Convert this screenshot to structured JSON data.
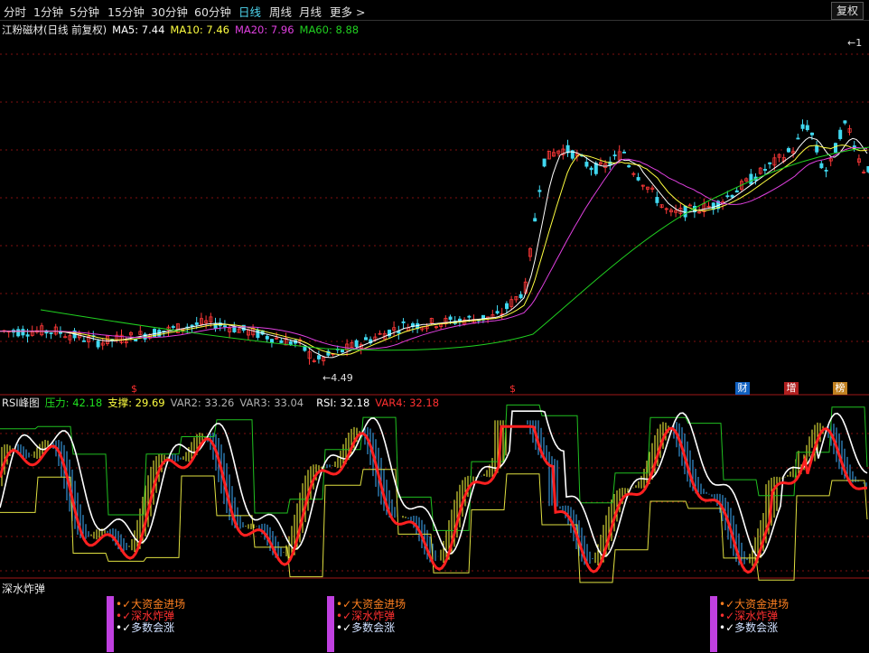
{
  "toolbar": {
    "tabs": [
      "分时",
      "1分钟",
      "5分钟",
      "15分钟",
      "30分钟",
      "60分钟",
      "日线",
      "周线",
      "月线",
      "更多 >"
    ],
    "active_tab": "日线",
    "restore_label": "复权"
  },
  "main_panel": {
    "stock_title": "江粉磁材(日线 前复权)",
    "ma5": "MA5: 7.44",
    "ma10": "MA10: 7.46",
    "ma20": "MA20: 7.96",
    "ma60": "MA60: 8.88",
    "low_label": "4.49",
    "high_label": "1",
    "markers": [
      "$",
      "$"
    ],
    "badges": [
      "财",
      "增",
      "榜"
    ]
  },
  "rsi_panel": {
    "title": "RSI峰图",
    "pressure": "压力: 42.18",
    "support": "支撑: 29.69",
    "var2": "VAR2: 33.26",
    "var3": "VAR3: 33.04",
    "rsi": "RSI: 32.18",
    "var4": "VAR4: 32.18"
  },
  "signal_panel": {
    "title": "深水炸弹",
    "items": [
      "大资金进场",
      "深水炸弹",
      "多数会涨"
    ]
  },
  "colors": {
    "up": "#ff3838",
    "down": "#40d8f0",
    "ma5": "#ffffff",
    "ma10": "#ffff40",
    "ma20": "#e040e0",
    "ma60": "#20d020",
    "grid": "#801010"
  }
}
